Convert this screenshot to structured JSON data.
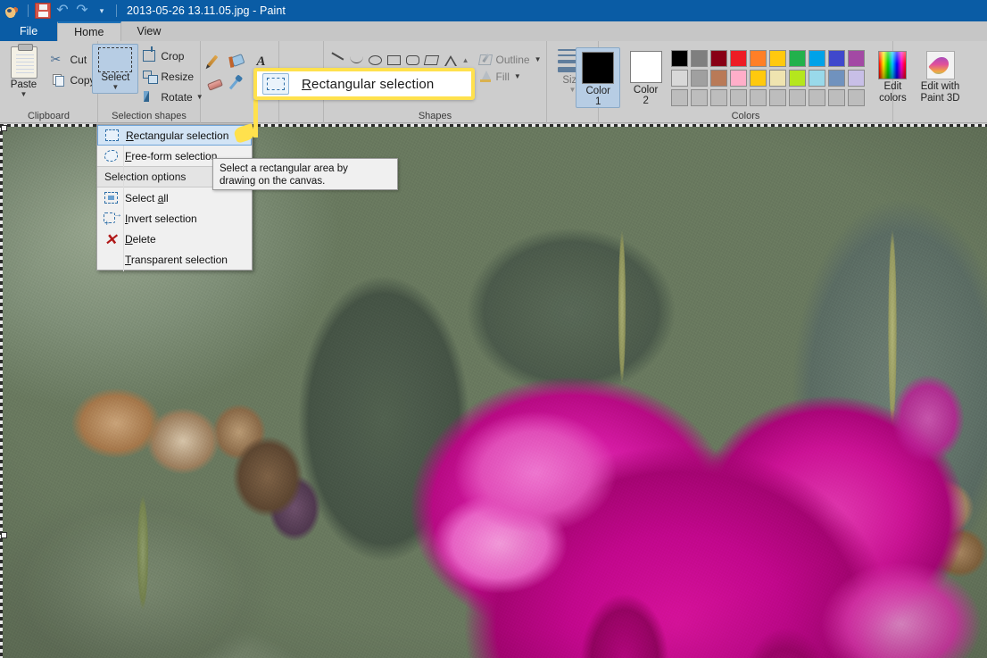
{
  "titlebar": {
    "document_title": "2013-05-26 13.11.05.jpg - Paint",
    "quick_access": [
      {
        "name": "paint-app-icon",
        "label": "Paint"
      },
      {
        "name": "save-icon",
        "label": "Save"
      },
      {
        "name": "undo-icon",
        "label": "Undo",
        "glyph": "↶"
      },
      {
        "name": "redo-icon",
        "label": "Redo",
        "glyph": "↷"
      },
      {
        "name": "customize-quick-access-icon",
        "label": "Customize Quick Access Toolbar",
        "glyph": "▾"
      }
    ]
  },
  "tabs": [
    {
      "id": "file",
      "label": "File"
    },
    {
      "id": "home",
      "label": "Home"
    },
    {
      "id": "view",
      "label": "View"
    }
  ],
  "ribbon": {
    "clipboard": {
      "group_label": "Clipboard",
      "paste_label": "Paste",
      "cut_label": "Cut",
      "copy_label": "Copy"
    },
    "image": {
      "group_label": "Selection shapes",
      "select_label": "Select",
      "crop_label": "Crop",
      "resize_label": "Resize",
      "rotate_label": "Rotate"
    },
    "tools": {
      "pencil": "Pencil",
      "fill": "Fill with color",
      "text": "Text",
      "eraser": "Eraser",
      "color_picker": "Color picker"
    },
    "shapes": {
      "group_label": "Shapes",
      "outline_label": "Outline",
      "fill_label": "Fill",
      "items": [
        "line",
        "curve",
        "oval",
        "rectangle",
        "rounded-rectangle",
        "polygon",
        "triangle"
      ]
    },
    "size": {
      "label": "Size"
    },
    "colors": {
      "group_label": "Colors",
      "color1_label": "Color 1",
      "color2_label": "Color 2",
      "color1_value": "#000000",
      "color2_value": "#ffffff",
      "edit_colors_label_line1": "Edit",
      "edit_colors_label_line2": "colors",
      "paint3d_label_line1": "Edit with",
      "paint3d_label_line2": "Paint 3D",
      "palette_row1": [
        "#000000",
        "#7f7f7f",
        "#880015",
        "#ed1c24",
        "#ff7f27",
        "#ffc90e",
        "#22b14c",
        "#00a2e8",
        "#3f48cc",
        "#a349a4"
      ],
      "palette_row2": [
        "#d8d8d8",
        "#a0a0a0",
        "#b97a57",
        "#ffaec9",
        "#ffc90e",
        "#efe4b0",
        "#b5e61d",
        "#99d9ea",
        "#7092be",
        "#c8bfe7"
      ],
      "palette_row3": [
        "#bdbdbd",
        "#bdbdbd",
        "#bdbdbd",
        "#bdbdbd",
        "#bdbdbd",
        "#bdbdbd",
        "#bdbdbd",
        "#bdbdbd",
        "#bdbdbd",
        "#bdbdbd"
      ]
    }
  },
  "select_menu": {
    "items": [
      {
        "id": "rectangular-selection",
        "label": "Rectangular selection",
        "accel": "R",
        "highlighted": true
      },
      {
        "id": "free-form-selection",
        "label": "Free-form selection",
        "accel": "F",
        "highlighted": false
      }
    ],
    "section_label": "Selection options",
    "options": [
      {
        "id": "select-all",
        "label": "Select all",
        "accel": "a"
      },
      {
        "id": "invert-selection",
        "label": "Invert selection",
        "accel": "I"
      },
      {
        "id": "delete",
        "label": "Delete",
        "accel": "D"
      },
      {
        "id": "transparent-selection",
        "label": "Transparent selection",
        "accel": "T"
      }
    ]
  },
  "tooltip": {
    "line1": "Select a rectangular area by",
    "line2": "drawing on the canvas."
  },
  "callout": {
    "label": "Rectangular selection",
    "accel": "R",
    "highlight_color": "#ffe14d"
  },
  "canvas": {
    "image_description": "Close-up photograph of a magenta rose in bloom with dark green rose leaves and dried brown spent blossoms",
    "selection_active": true
  },
  "colors": {
    "titlebar_blue": "#0a5ca5",
    "ribbon_gray": "#cdcdcd",
    "accent_highlight": "#ffe14d",
    "menu_bg": "#f0f0f0"
  }
}
